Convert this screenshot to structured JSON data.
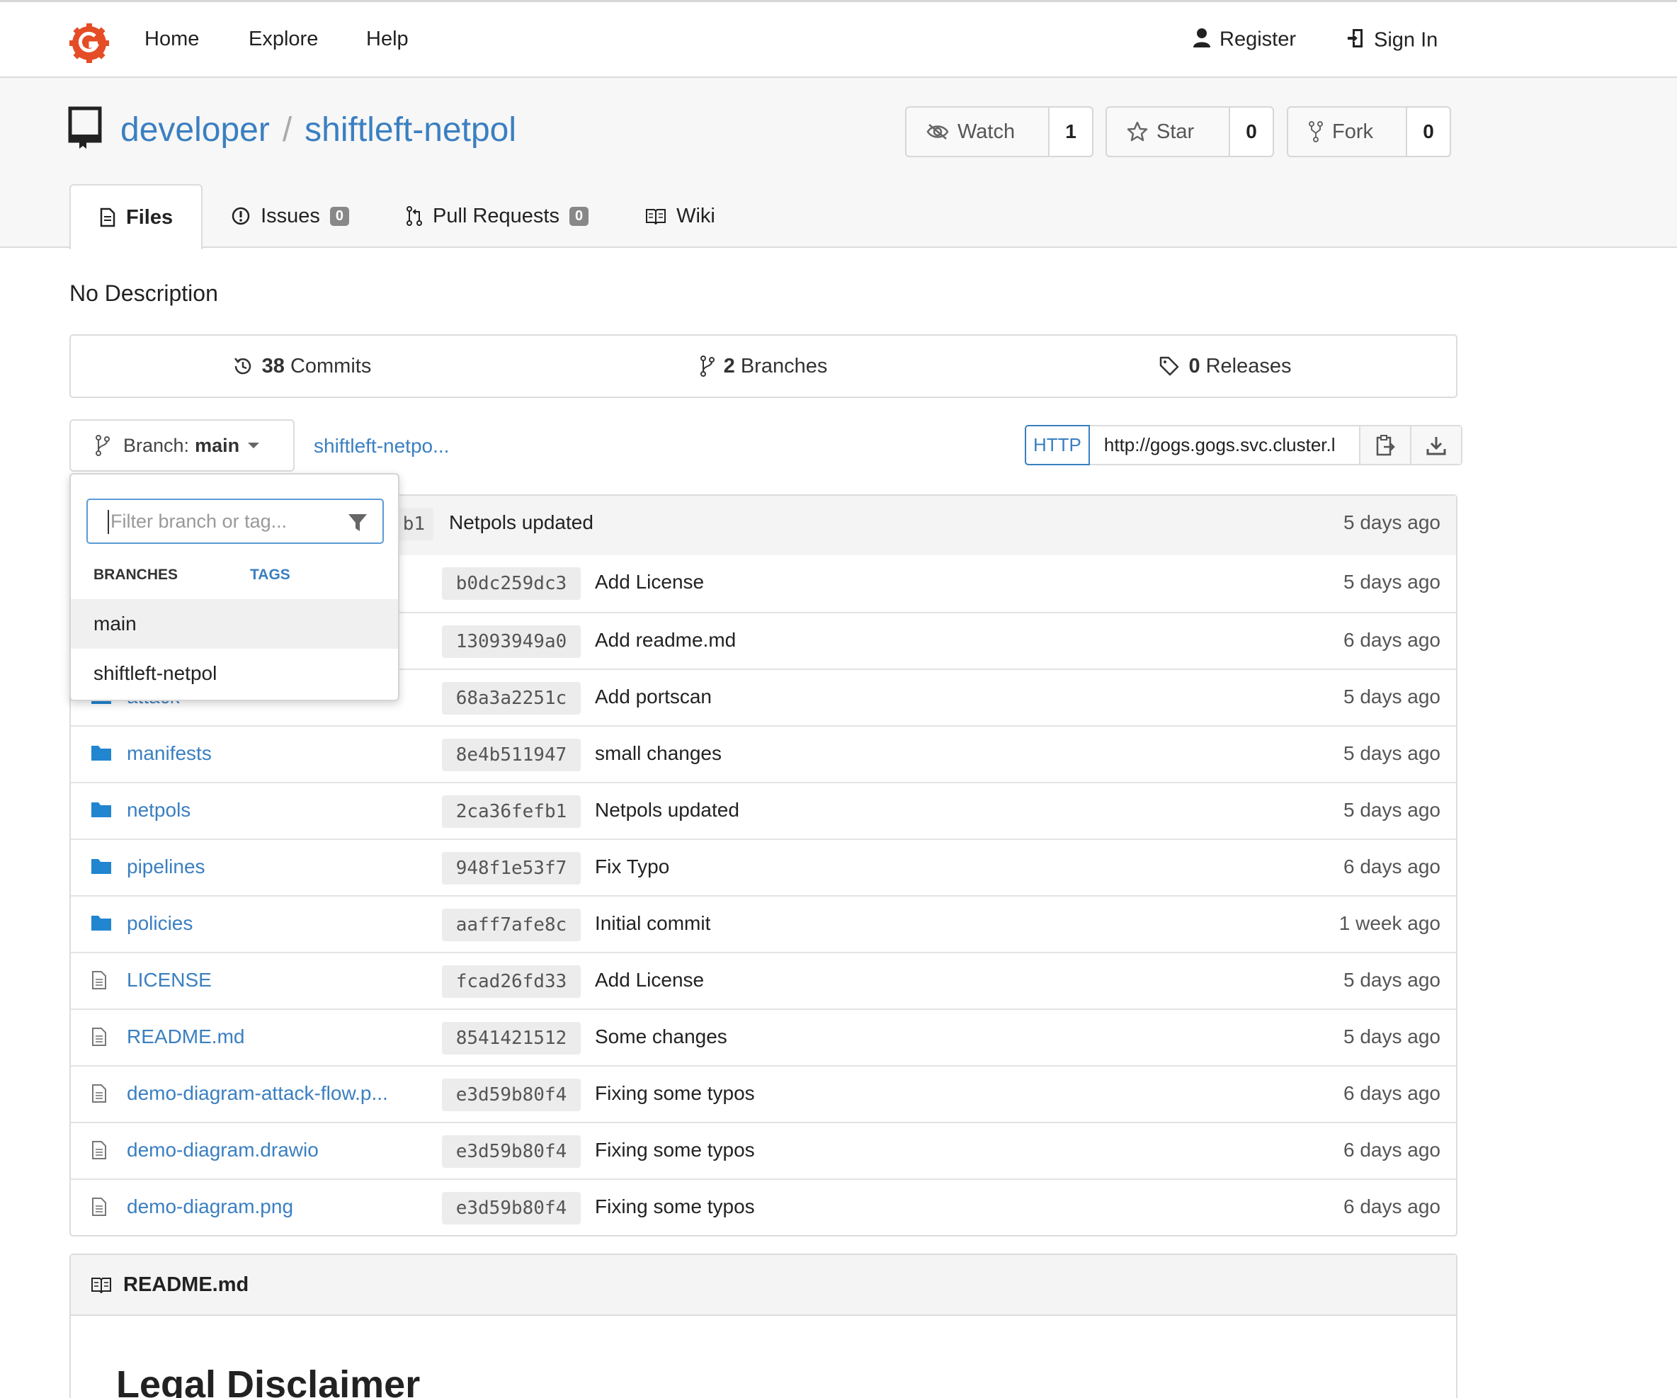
{
  "nav": {
    "home": "Home",
    "explore": "Explore",
    "help": "Help",
    "register": "Register",
    "sign_in": "Sign In",
    "accent": "#e44d26"
  },
  "repo": {
    "owner": "developer",
    "separator": "/",
    "name": "shiftleft-netpol",
    "watch_label": "Watch",
    "watch_count": "1",
    "star_label": "Star",
    "star_count": "0",
    "fork_label": "Fork",
    "fork_count": "0"
  },
  "tabs": [
    {
      "label": "Files"
    },
    {
      "label": "Issues",
      "badge": "0"
    },
    {
      "label": "Pull Requests",
      "badge": "0"
    },
    {
      "label": "Wiki"
    }
  ],
  "description": "No Description",
  "stats": {
    "commits_count": "38",
    "commits_label": "Commits",
    "branches_count": "2",
    "branches_label": "Branches",
    "releases_count": "0",
    "releases_label": "Releases"
  },
  "branch": {
    "prefix": "Branch:",
    "current": "main",
    "breadcrumb": "shiftleft-netpo..."
  },
  "clone": {
    "protocol": "HTTP",
    "url": "http://gogs.gogs.svc.cluster.l"
  },
  "dropdown": {
    "placeholder": "Filter branch or tag...",
    "branches_tab": "BRANCHES",
    "tags_tab": "TAGS",
    "items": [
      "main",
      "shiftleft-netpol"
    ]
  },
  "latest_commit": {
    "sha": "b1",
    "message": "Netpols updated",
    "age": "5 days ago"
  },
  "files": [
    {
      "name": "",
      "type": "folder",
      "sha": "b0dc259dc3",
      "message": "Add License",
      "age": "5 days ago"
    },
    {
      "name": "",
      "type": "folder",
      "sha": "13093949a0",
      "message": "Add readme.md",
      "age": "6 days ago"
    },
    {
      "name": "attack",
      "type": "folder",
      "sha": "68a3a2251c",
      "message": "Add portscan",
      "age": "5 days ago"
    },
    {
      "name": "manifests",
      "type": "folder",
      "sha": "8e4b511947",
      "message": "small changes",
      "age": "5 days ago"
    },
    {
      "name": "netpols",
      "type": "folder",
      "sha": "2ca36fefb1",
      "message": "Netpols updated",
      "age": "5 days ago"
    },
    {
      "name": "pipelines",
      "type": "folder",
      "sha": "948f1e53f7",
      "message": "Fix Typo",
      "age": "6 days ago"
    },
    {
      "name": "policies",
      "type": "folder",
      "sha": "aaff7afe8c",
      "message": "Initial commit",
      "age": "1 week ago"
    },
    {
      "name": "LICENSE",
      "type": "file",
      "sha": "fcad26fd33",
      "message": "Add License",
      "age": "5 days ago"
    },
    {
      "name": "README.md",
      "type": "file",
      "sha": "8541421512",
      "message": "Some changes",
      "age": "5 days ago"
    },
    {
      "name": "demo-diagram-attack-flow.p...",
      "type": "file",
      "sha": "e3d59b80f4",
      "message": "Fixing some typos",
      "age": "6 days ago"
    },
    {
      "name": "demo-diagram.drawio",
      "type": "file",
      "sha": "e3d59b80f4",
      "message": "Fixing some typos",
      "age": "6 days ago"
    },
    {
      "name": "demo-diagram.png",
      "type": "file",
      "sha": "e3d59b80f4",
      "message": "Fixing some typos",
      "age": "6 days ago"
    }
  ],
  "readme": {
    "filename": "README.md",
    "heading": "Legal Disclaimer"
  }
}
